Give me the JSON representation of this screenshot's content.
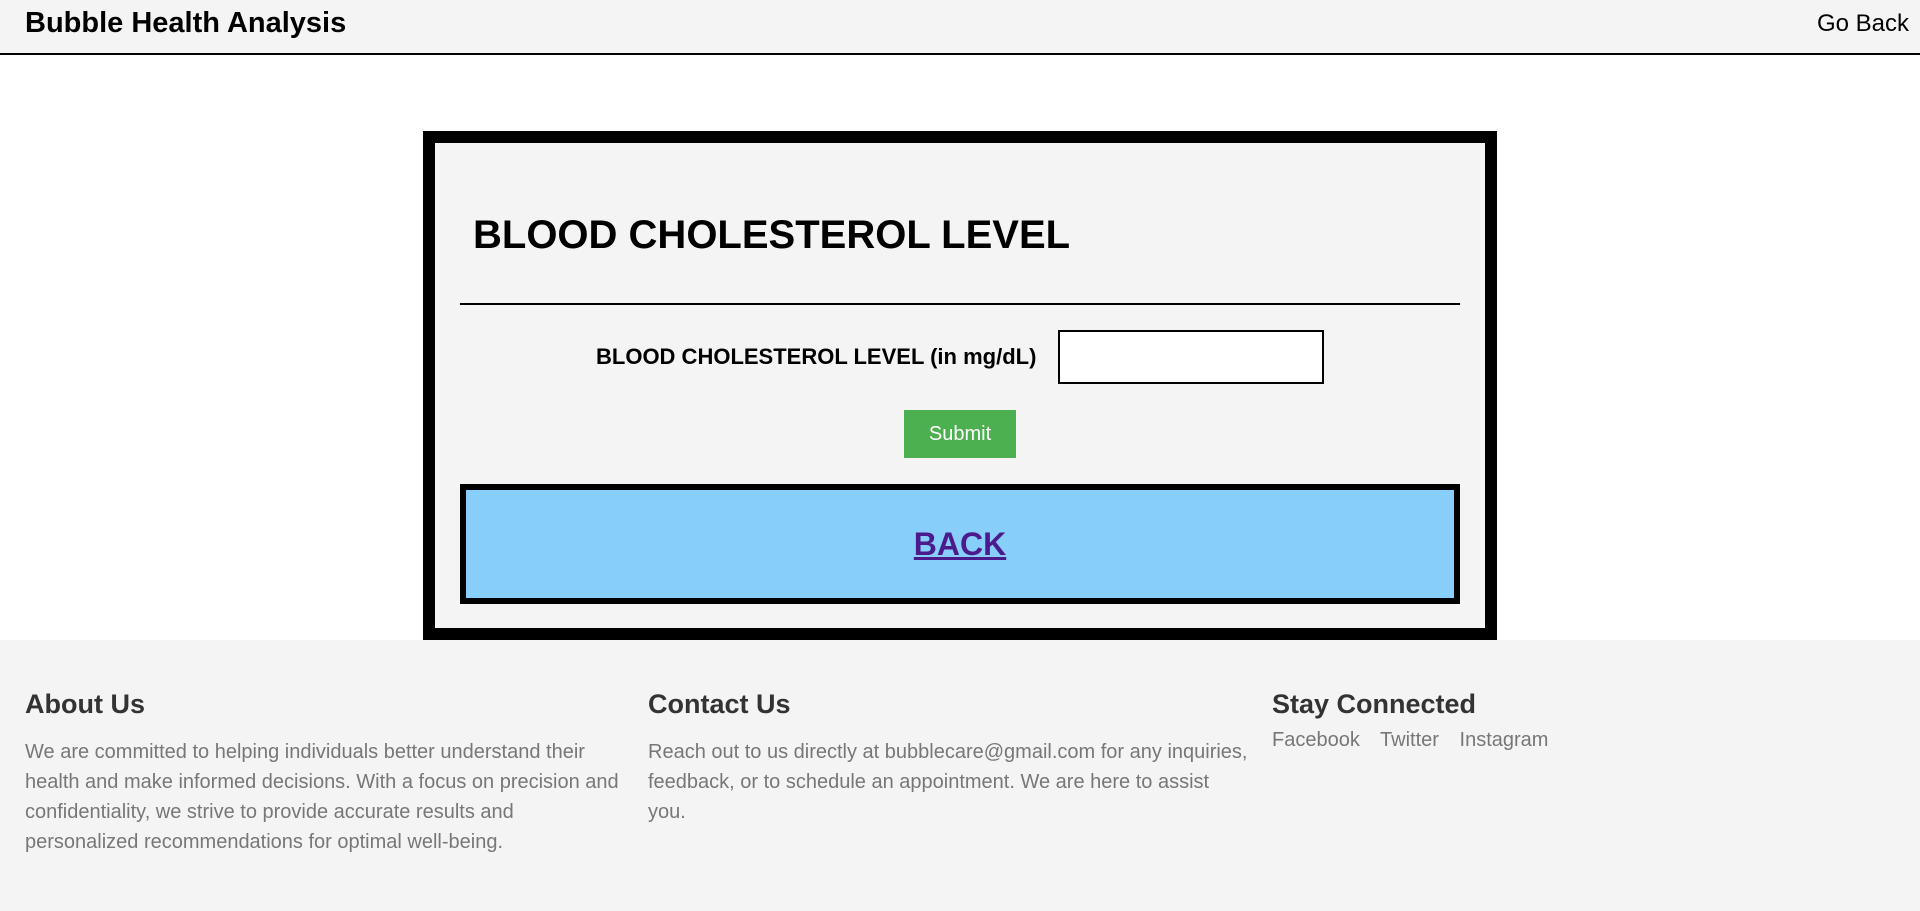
{
  "header": {
    "brand": "Bubble Health Analysis",
    "go_back_label": "Go Back"
  },
  "card": {
    "title": "BLOOD CHOLESTEROL LEVEL",
    "field_label": "BLOOD CHOLESTEROL LEVEL (in mg/dL)",
    "field_value": "",
    "submit_label": "Submit",
    "back_label": "BACK",
    "back_bg_color": "#87cefa",
    "back_link_color": "#4b1a8c",
    "submit_color": "#4caf50"
  },
  "footer": {
    "about": {
      "heading": "About Us",
      "text": "We are committed to helping individuals better understand their health and make informed decisions. With a focus on precision and confidentiality, we strive to provide accurate results and personalized recommendations for optimal well-being."
    },
    "contact": {
      "heading": "Contact Us",
      "text": "Reach out to us directly at bubblecare@gmail.com for any inquiries, feedback, or to schedule an appointment. We are here to assist you."
    },
    "social": {
      "heading": "Stay Connected",
      "links": [
        "Facebook",
        "Twitter",
        "Instagram"
      ]
    }
  }
}
